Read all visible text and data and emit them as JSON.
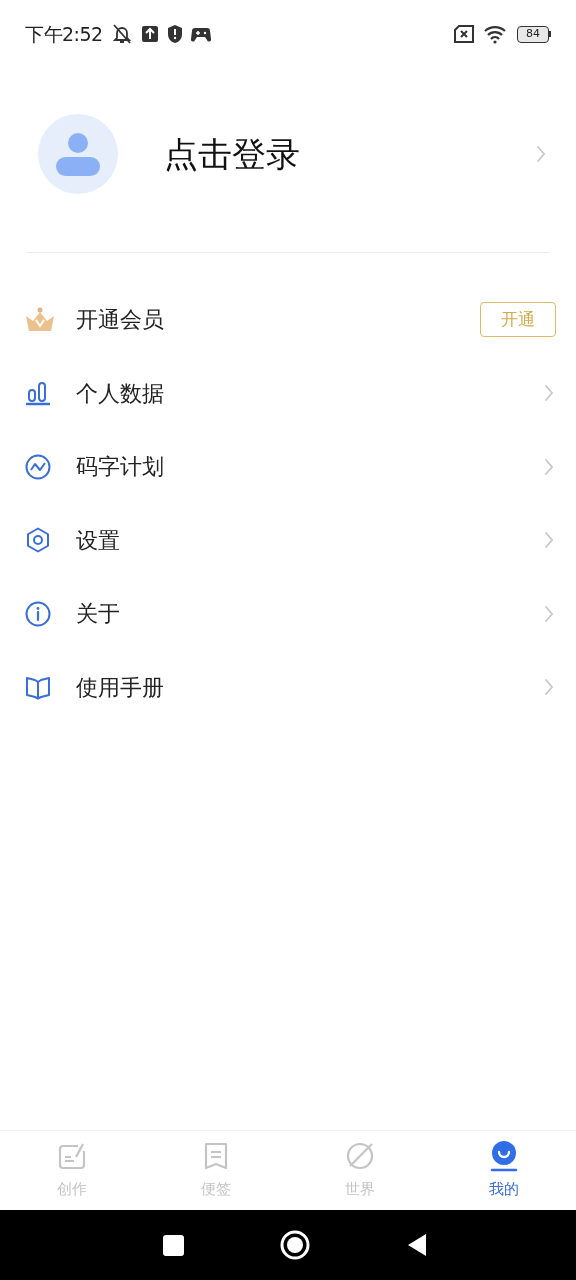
{
  "status_bar": {
    "time": "下午2:52",
    "battery": "84"
  },
  "profile": {
    "login_label": "点击登录"
  },
  "menu": [
    {
      "kind": "vip",
      "label": "开通会员",
      "action": "开通"
    },
    {
      "kind": "link",
      "label": "个人数据"
    },
    {
      "kind": "link",
      "label": "码字计划"
    },
    {
      "kind": "link",
      "label": "设置"
    },
    {
      "kind": "link",
      "label": "关于"
    },
    {
      "kind": "link",
      "label": "使用手册"
    }
  ],
  "bottom_nav": [
    {
      "label": "创作",
      "selected": false
    },
    {
      "label": "便签",
      "selected": false
    },
    {
      "label": "世界",
      "selected": false
    },
    {
      "label": "我的",
      "selected": true
    }
  ]
}
